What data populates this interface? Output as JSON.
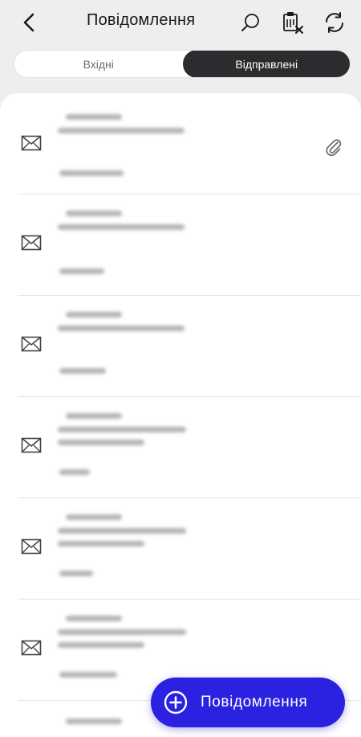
{
  "header": {
    "title": "Повідомлення",
    "back_icon": "chevron-left-icon",
    "search_icon": "search-icon",
    "delete_icon": "clipboard-delete-icon",
    "refresh_icon": "refresh-icon"
  },
  "tabs": [
    {
      "label": "Вхідні",
      "active": false
    },
    {
      "label": "Відправлені",
      "active": true
    }
  ],
  "messages": [
    {
      "icon": "envelope-icon",
      "has_attachment": true,
      "content_obscured": true
    },
    {
      "icon": "envelope-icon",
      "has_attachment": false,
      "content_obscured": true
    },
    {
      "icon": "envelope-icon",
      "has_attachment": false,
      "content_obscured": true
    },
    {
      "icon": "envelope-icon",
      "has_attachment": false,
      "content_obscured": true
    },
    {
      "icon": "envelope-icon",
      "has_attachment": false,
      "content_obscured": true
    },
    {
      "icon": "envelope-icon",
      "has_attachment": false,
      "content_obscured": true
    }
  ],
  "fab": {
    "label": "Повідомлення",
    "icon": "plus-circle-icon"
  },
  "colors": {
    "background": "#eeeef1",
    "accent": "#2a22e0",
    "active_tab": "#2c2c2e",
    "text": "#1a1a1a"
  }
}
